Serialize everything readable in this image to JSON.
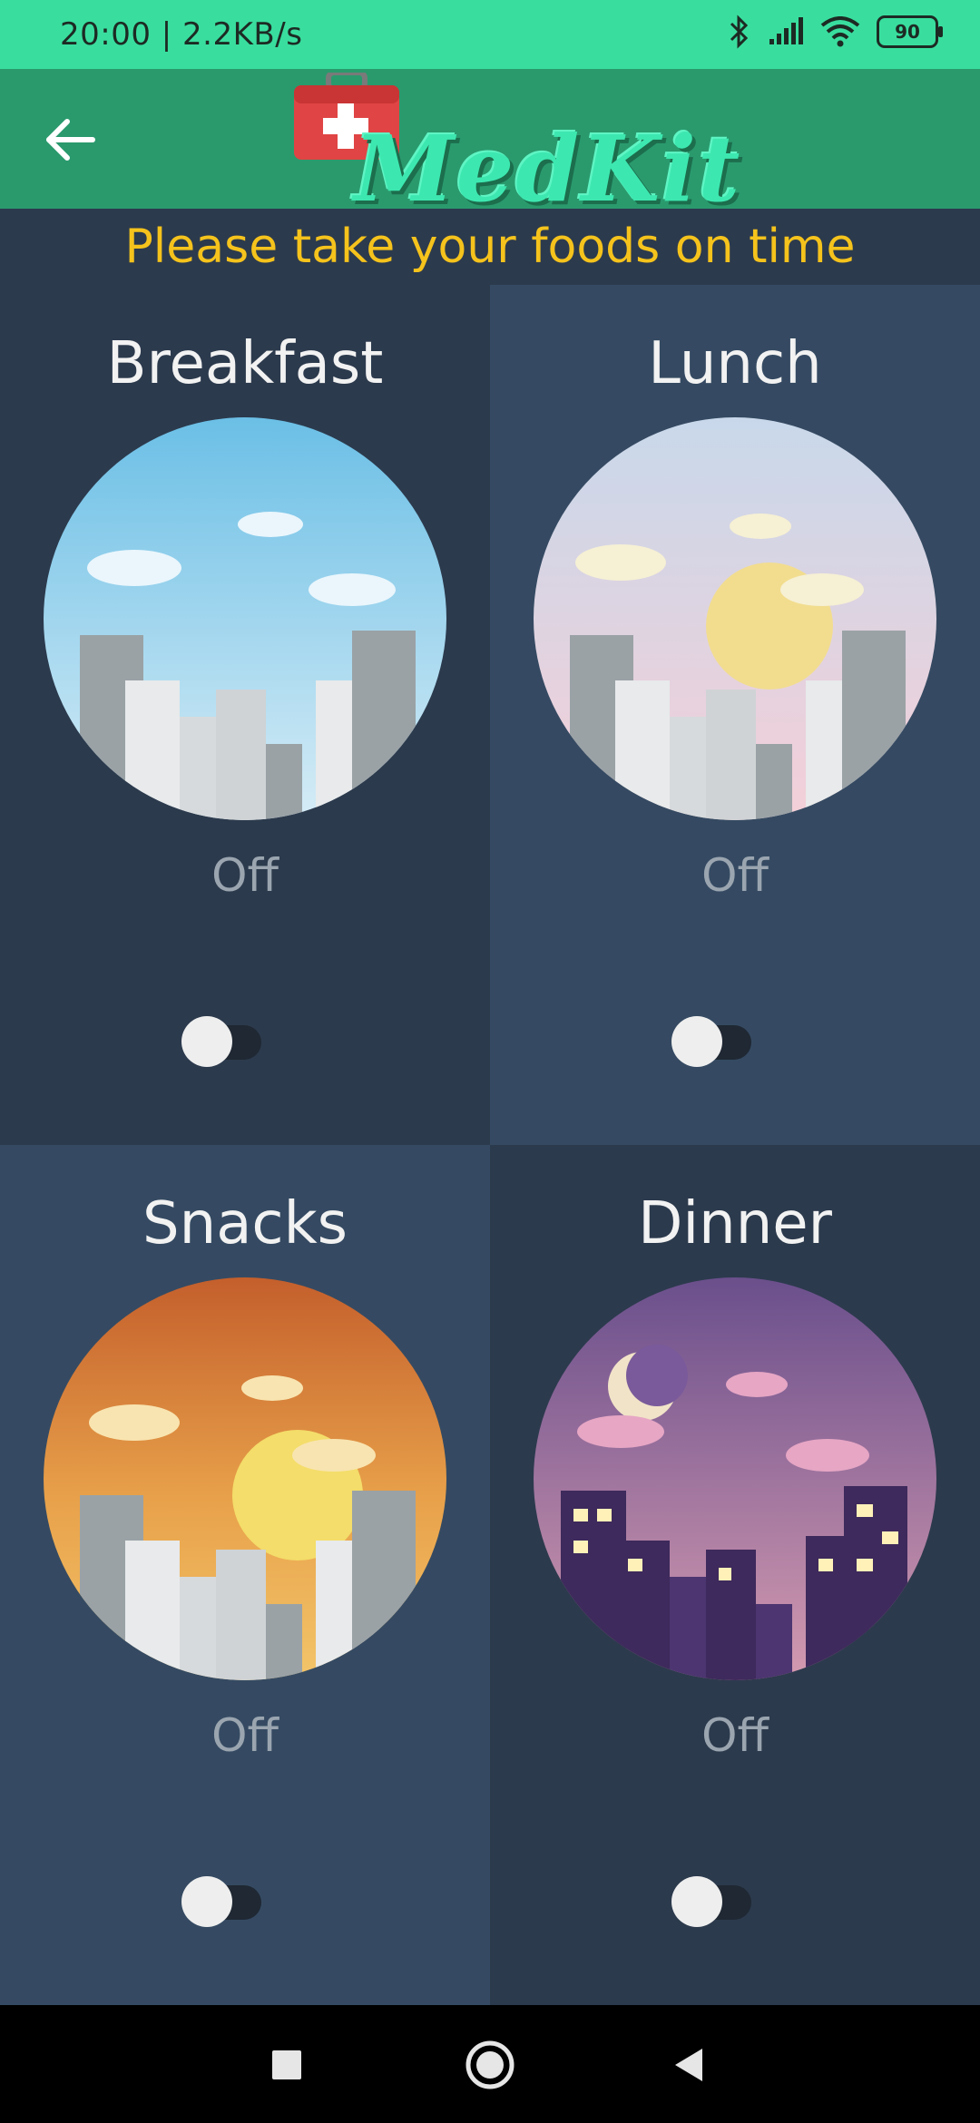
{
  "status_bar": {
    "time_speed": "20:00 | 2.2KB/s",
    "battery": "90",
    "icons": [
      "bluetooth-icon",
      "signal-icon",
      "wifi-icon",
      "battery-icon"
    ]
  },
  "app_bar": {
    "logo_text": "MedKit",
    "back_icon": "arrow-left-icon",
    "logo_icon": "medical-kit-icon"
  },
  "banner": {
    "text": "Please take your foods on time"
  },
  "meals": [
    {
      "title": "Breakfast",
      "status": "Off",
      "enabled": false,
      "scene": "morning-city"
    },
    {
      "title": "Lunch",
      "status": "Off",
      "enabled": false,
      "scene": "noon-city"
    },
    {
      "title": "Snacks",
      "status": "Off",
      "enabled": false,
      "scene": "afternoon-city"
    },
    {
      "title": "Dinner",
      "status": "Off",
      "enabled": false,
      "scene": "night-city"
    }
  ],
  "nav_bar": {
    "icons": [
      "recents-square-icon",
      "home-circle-icon",
      "back-triangle-icon"
    ]
  },
  "colors": {
    "status_bar": "#39de9e",
    "app_bar": "#2a9a6d",
    "banner_text": "#f5c31c",
    "background": "#2c3a4d",
    "alt_cell": "#354a62"
  }
}
